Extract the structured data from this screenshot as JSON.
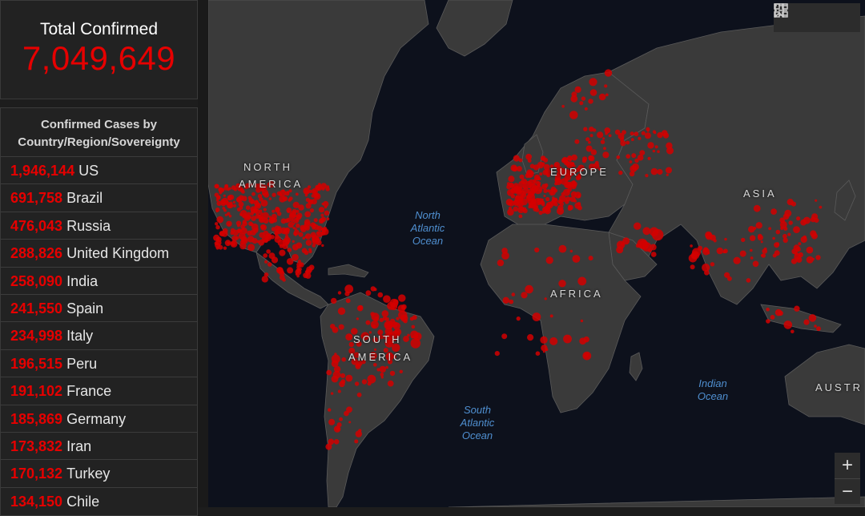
{
  "total": {
    "label": "Total Confirmed",
    "value": "7,049,649"
  },
  "list": {
    "title_line1": "Confirmed Cases by",
    "title_line2": "Country/Region/Sovereignty",
    "items": [
      {
        "count": "1,946,144",
        "name": "US"
      },
      {
        "count": "691,758",
        "name": "Brazil"
      },
      {
        "count": "476,043",
        "name": "Russia"
      },
      {
        "count": "288,826",
        "name": "United Kingdom"
      },
      {
        "count": "258,090",
        "name": "India"
      },
      {
        "count": "241,550",
        "name": "Spain"
      },
      {
        "count": "234,998",
        "name": "Italy"
      },
      {
        "count": "196,515",
        "name": "Peru"
      },
      {
        "count": "191,102",
        "name": "France"
      },
      {
        "count": "185,869",
        "name": "Germany"
      },
      {
        "count": "173,832",
        "name": "Iran"
      },
      {
        "count": "170,132",
        "name": "Turkey"
      },
      {
        "count": "134,150",
        "name": "Chile"
      }
    ]
  },
  "map": {
    "regions": {
      "north_america_1": "NORTH",
      "north_america_2": "AMERICA",
      "europe": "EUROPE",
      "asia": "ASIA",
      "africa": "AFRICA",
      "south_america_1": "SOUTH",
      "south_america_2": "AMERICA",
      "australia": "AUSTR"
    },
    "oceans": {
      "north_atlantic_1": "North",
      "north_atlantic_2": "Atlantic",
      "north_atlantic_3": "Ocean",
      "south_atlantic_1": "South",
      "south_atlantic_2": "Atlantic",
      "south_atlantic_3": "Ocean",
      "indian_1": "Indian",
      "indian_2": "Ocean"
    },
    "zoom_in": "+",
    "zoom_out": "−"
  },
  "colors": {
    "accent": "#e60000",
    "land": "#3a3a3a",
    "ocean": "#0d111c",
    "ocean_label": "#4f8fd0"
  },
  "icons": [
    "bookmark-icon",
    "list-icon",
    "qr-icon"
  ]
}
